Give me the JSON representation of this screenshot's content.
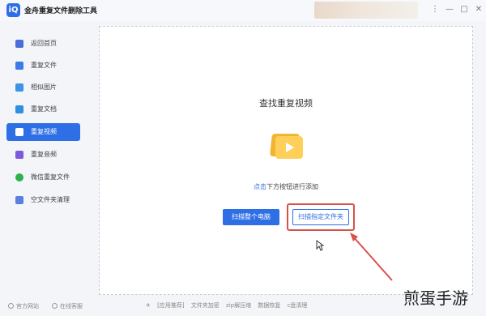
{
  "titlebar": {
    "app_title": "金舟重复文件删除工具",
    "logo_text": "iQ"
  },
  "window_controls": [
    "⋮",
    "—",
    "□",
    "✕"
  ],
  "sidebar": {
    "items": [
      {
        "label": "返回首页",
        "icon": "home-icon",
        "color": "#4a6fd6"
      },
      {
        "label": "重复文件",
        "icon": "file-icon",
        "color": "#3d7be8"
      },
      {
        "label": "相似图片",
        "icon": "image-icon",
        "color": "#3b94e6"
      },
      {
        "label": "重复文档",
        "icon": "document-icon",
        "color": "#2f8fe0"
      },
      {
        "label": "重复视频",
        "icon": "video-icon",
        "color": "#ffffff",
        "active": true
      },
      {
        "label": "重复音频",
        "icon": "audio-icon",
        "color": "#7b5bd9"
      },
      {
        "label": "微信重复文件",
        "icon": "wechat-icon",
        "color": "#2fb14a"
      },
      {
        "label": "空文件夹清理",
        "icon": "folder-icon",
        "color": "#5a7fe0"
      }
    ]
  },
  "footer": {
    "website": "官方网站",
    "support": "在线客服"
  },
  "main": {
    "title": "查找重复视频",
    "hint_link": "点击",
    "hint_text": "下方按钮进行添加",
    "scan_all_label": "扫描整个电脑",
    "scan_folder_label": "扫描指定文件夹"
  },
  "bottombar": {
    "items": [
      "[应用推荐]",
      "文件夹加密",
      "zip解压缩",
      "数据恢复",
      "c盘清理"
    ]
  },
  "watermark": "煎蛋手游",
  "colors": {
    "accent": "#2f6fe6",
    "highlight": "#d8514b"
  }
}
